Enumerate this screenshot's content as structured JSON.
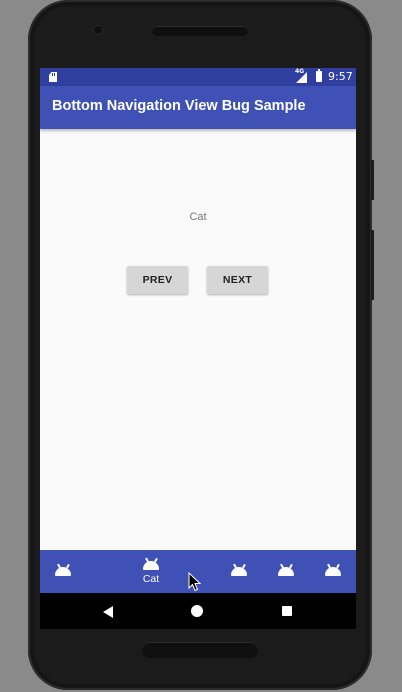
{
  "status_bar": {
    "time": "9:57",
    "network_label": "4G",
    "icons": [
      "sd-card-icon",
      "signal-icon",
      "battery-icon"
    ]
  },
  "app_bar": {
    "title": "Bottom Navigation View Bug Sample"
  },
  "content": {
    "label": "Cat",
    "prev_label": "PREV",
    "next_label": "NEXT"
  },
  "bottom_nav": {
    "items": [
      {
        "label": "",
        "icon": "android-icon",
        "selected": false
      },
      {
        "label": "Cat",
        "icon": "android-icon",
        "selected": true
      },
      {
        "label": "",
        "icon": "android-icon",
        "selected": false
      },
      {
        "label": "",
        "icon": "android-icon",
        "selected": false
      },
      {
        "label": "",
        "icon": "android-icon",
        "selected": false
      }
    ]
  },
  "system_nav": {
    "icons": [
      "back-icon",
      "home-icon",
      "recents-icon"
    ]
  },
  "colors": {
    "primary": "#3f51b5",
    "primary_dark": "#303f9f",
    "background": "#fafafa",
    "button": "#d6d6d6"
  }
}
